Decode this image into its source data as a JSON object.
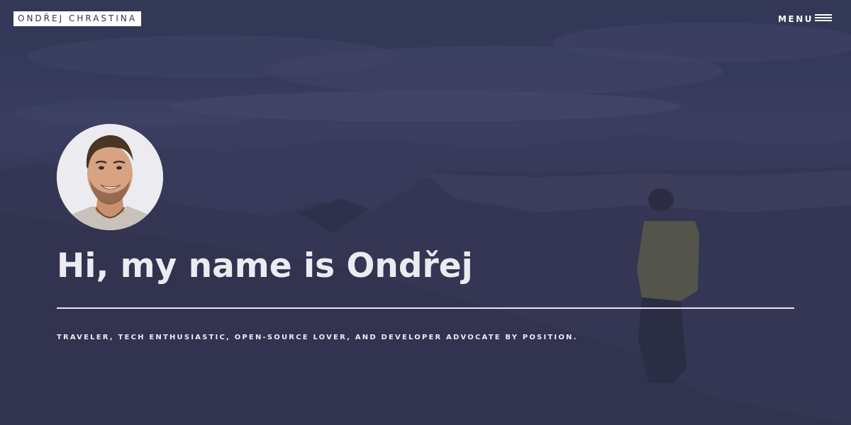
{
  "header": {
    "logo_text": "ONDŘEJ CHRASTINA",
    "menu_label": "MENU",
    "menu_icon": "hamburger-icon"
  },
  "hero": {
    "avatar_alt": "profile-photo",
    "headline": "Hi, my name is Ondřej",
    "tagline": "TRAVELER, TECH ENTHUSIASTIC, OPEN-SOURCE LOVER, AND DEVELOPER ADVOCATE BY POSITION."
  },
  "colors": {
    "overlay": "#2c3050",
    "text": "#ecebf2",
    "logo_bg": "#ffffff"
  }
}
